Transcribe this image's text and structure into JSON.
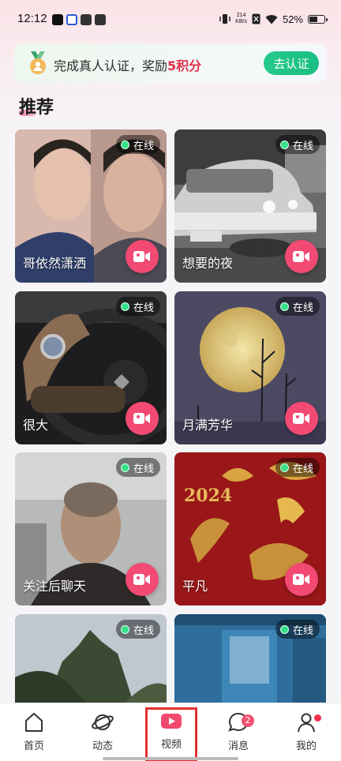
{
  "status_bar": {
    "time": "12:12",
    "net_speed_value": "214",
    "net_speed_unit": "KB/s",
    "battery": "52%"
  },
  "banner": {
    "text_prefix": "完成真人认证，奖励",
    "points": "5积分",
    "button": "去认证"
  },
  "section": {
    "title": "推荐"
  },
  "cards": [
    {
      "name": "哥依然潇洒",
      "status": "在线"
    },
    {
      "name": "想要的夜",
      "status": "在线"
    },
    {
      "name": "很大",
      "status": "在线"
    },
    {
      "name": "月满芳华",
      "status": "在线"
    },
    {
      "name": "关注后聊天",
      "status": "在线"
    },
    {
      "name": "平凡",
      "status": "在线"
    },
    {
      "name": "",
      "status": "在线"
    },
    {
      "name": "",
      "status": "在线"
    }
  ],
  "card_poster_text": "2024",
  "nav": {
    "items": [
      {
        "label": "首页"
      },
      {
        "label": "动态"
      },
      {
        "label": "视频"
      },
      {
        "label": "消息",
        "badge": "2"
      },
      {
        "label": "我的"
      }
    ],
    "active": "视频"
  },
  "colors": {
    "accent": "#f24a73",
    "online": "#38e08a",
    "verify": "#25c98b"
  }
}
